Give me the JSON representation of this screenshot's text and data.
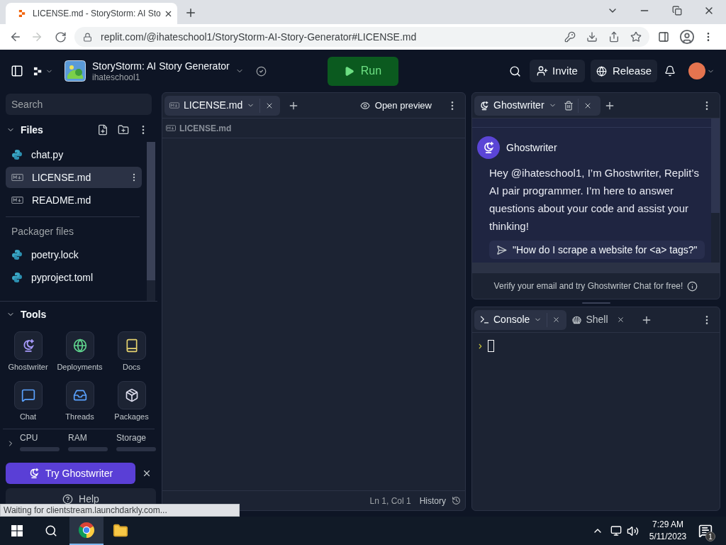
{
  "browser": {
    "tab_title": "LICENSE.md - StoryStorm: AI Sto",
    "url": "replit.com/@ihateschool1/StoryStorm-AI-Story-Generator#LICENSE.md",
    "status": "Waiting for clientstream.launchdarkly.com..."
  },
  "header": {
    "project_title": "StoryStorm: AI Story Generator",
    "owner": "ihateschool1",
    "run": "Run",
    "invite": "Invite",
    "release": "Release"
  },
  "sidebar": {
    "search": {
      "placeholder": "Search"
    },
    "files_title": "Files",
    "files": [
      {
        "name": "chat.py",
        "kind": "python",
        "selected": false
      },
      {
        "name": "LICENSE.md",
        "kind": "markdown",
        "selected": true
      },
      {
        "name": "README.md",
        "kind": "markdown",
        "selected": false
      }
    ],
    "packager_title": "Packager files",
    "packager_files": [
      {
        "name": "poetry.lock",
        "kind": "python",
        "selected": false
      },
      {
        "name": "pyproject.toml",
        "kind": "python",
        "selected": false
      }
    ],
    "tools_title": "Tools",
    "tools": [
      {
        "label": "Ghostwriter",
        "kind": "ghostwriter"
      },
      {
        "label": "Deployments",
        "kind": "deployments"
      },
      {
        "label": "Docs",
        "kind": "docs"
      },
      {
        "label": "Chat",
        "kind": "chat"
      },
      {
        "label": "Threads",
        "kind": "threads"
      },
      {
        "label": "Packages",
        "kind": "packages"
      }
    ],
    "resources": [
      "CPU",
      "RAM",
      "Storage"
    ],
    "try_button": "Try Ghostwriter",
    "help_button": "Help"
  },
  "editor": {
    "tabs": [
      {
        "label": "LICENSE.md",
        "kind": "markdown",
        "selected": true
      }
    ],
    "open_preview": "Open preview",
    "breadcrumb": "LICENSE.md",
    "position": "Ln 1, Col 1",
    "history": "History"
  },
  "ghostwriter": {
    "tabs": [
      {
        "label": "Ghostwriter",
        "selected": true
      }
    ],
    "sender": "Ghostwriter",
    "message": "Hey @ihateschool1, I’m Ghostwriter, Replit’s AI pair programmer. I’m here to answer questions about your code and assist your thinking!",
    "suggestion": "\"How do I scrape a website for <a> tags?\"",
    "footer": "Verify your email and try Ghostwriter Chat for free!"
  },
  "console": {
    "tabs": [
      {
        "label": "Console",
        "kind": "console",
        "selected": true
      },
      {
        "label": "Shell",
        "kind": "shell",
        "selected": false
      }
    ]
  },
  "taskbar": {
    "time": "7:29 AM",
    "date": "5/11/2023",
    "notifications": "1"
  }
}
